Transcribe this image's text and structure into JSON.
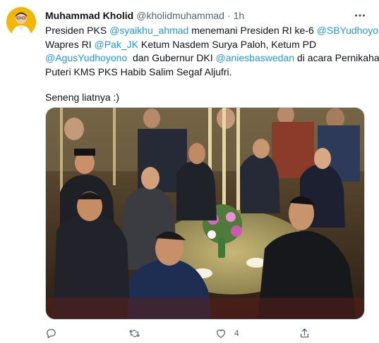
{
  "tweet": {
    "author": {
      "display_name": "Muhammad Kholid",
      "handle": "@kholidmuhammad",
      "avatar_icon": "user-avatar"
    },
    "separator": "·",
    "time": "1h",
    "text_segments": {
      "l1_a": "Presiden PKS ",
      "l1_m1": "@syaikhu_ahmad",
      "l1_b": " menemani Presiden RI ke-6 ",
      "l1_m2": "@SBYudhoyono",
      "l2_a": "Wapres RI ",
      "l2_m1": "@Pak_JK",
      "l2_b": " Ketum Nasdem Surya Paloh, Ketum PD",
      "l3_m1": "@AgusYudhoyono",
      "l3_a": "  dan Gubernur DKI ",
      "l3_m2": "@aniesbaswedan",
      "l3_b": " di acara Pernikahan",
      "l4": "Puteri KMS PKS Habib Salim Segaf Aljufri.",
      "l5": "Seneng liatnya :)"
    },
    "media": {
      "type": "photo",
      "description_icon": "event-photo"
    },
    "actions": {
      "reply_icon": "reply-icon",
      "retweet_icon": "retweet-icon",
      "like_icon": "heart-icon",
      "like_count": "4",
      "share_icon": "share-icon"
    },
    "colors": {
      "link": "#1d9bf0",
      "secondary_text": "#536471",
      "avatar_bg": "#f2b705"
    }
  }
}
